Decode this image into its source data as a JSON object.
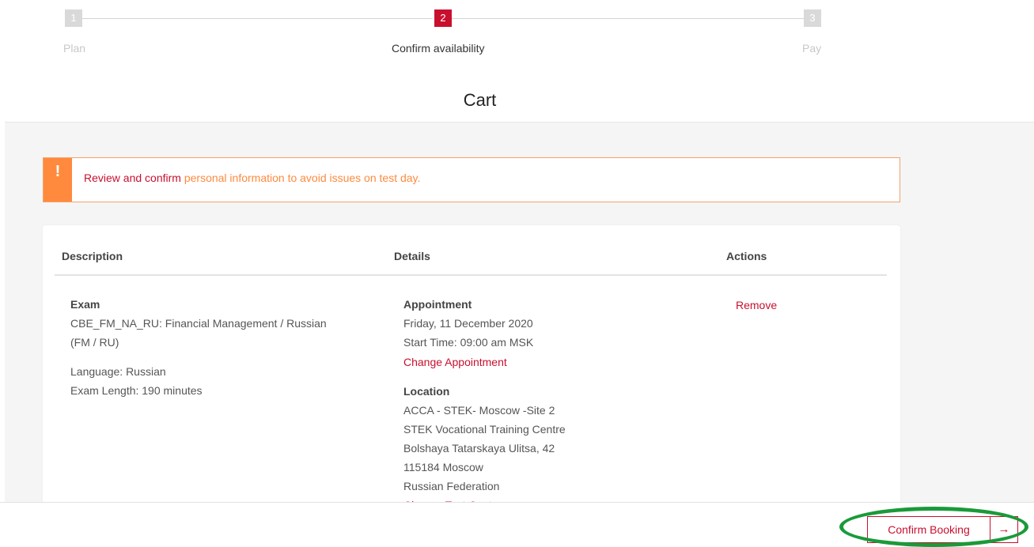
{
  "stepper": {
    "steps": [
      {
        "number": "1",
        "label": "Plan",
        "state": "inactive"
      },
      {
        "number": "2",
        "label": "Confirm availability",
        "state": "active"
      },
      {
        "number": "3",
        "label": "Pay",
        "state": "inactive"
      }
    ]
  },
  "page": {
    "title": "Cart"
  },
  "alert": {
    "icon": "!",
    "strong_text": "Review and confirm",
    "rest_text": "personal information to avoid issues on test day."
  },
  "cart": {
    "headers": {
      "description": "Description",
      "details": "Details",
      "actions": "Actions"
    },
    "item": {
      "exam_label": "Exam",
      "exam_name_line1": "CBE_FM_NA_RU: Financial Management / Russian",
      "exam_name_line2": "(FM / RU)",
      "language": "Language: Russian",
      "length": "Exam Length: 190 minutes",
      "appointment_label": "Appointment",
      "appointment_date": "Friday, 11 December 2020",
      "start_time": "Start Time: 09:00 am MSK",
      "change_appointment": "Change Appointment",
      "location_label": "Location",
      "location_lines": [
        "ACCA - STEK- Moscow -Site 2",
        "STEK Vocational Training Centre",
        "Bolshaya Tatarskaya Ulitsa, 42",
        "115184 Moscow",
        "Russian Federation"
      ],
      "change_test_centre": "Change Test Centre",
      "remove": "Remove"
    }
  },
  "footer": {
    "confirm_label": "Confirm Booking",
    "arrow": "→"
  },
  "colors": {
    "brand_red": "#c8102e",
    "alert_orange": "#ff8a3d",
    "highlight_green": "#1a9a3a"
  }
}
